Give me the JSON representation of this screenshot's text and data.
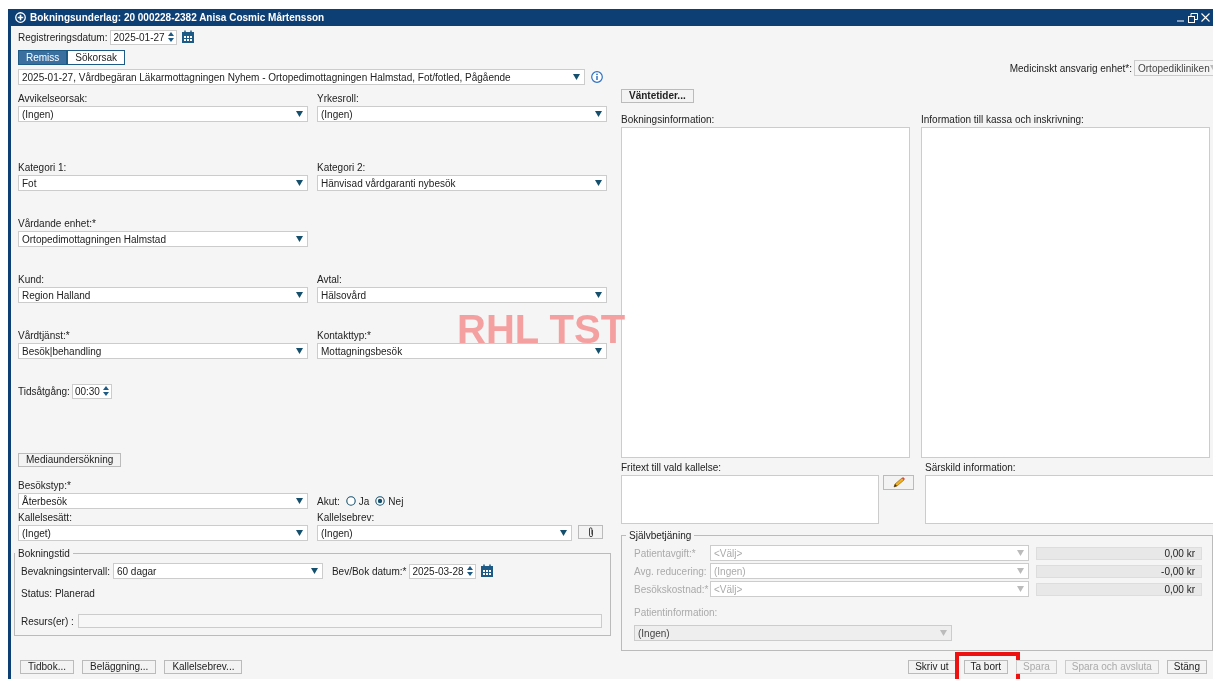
{
  "window": {
    "title": "Bokningsunderlag: 20 000228-2382 Anisa Cosmic Mårtensson"
  },
  "registration": {
    "label": "Registreringsdatum:",
    "value": "2025-01-27"
  },
  "tabs": [
    {
      "label": "Remiss",
      "selected": true
    },
    {
      "label": "Sökorsak",
      "selected": false
    }
  ],
  "referral": {
    "value": "2025-01-27, Vårdbegäran Läkarmottagningen Nyhem - Ortopedimottagningen Halmstad, Fot/fotled, Pågående"
  },
  "field_rows": [
    {
      "fields": [
        {
          "label": "Avvikelseorsak:",
          "value": "(Ingen)"
        },
        {
          "label": "Yrkesroll:",
          "value": "(Ingen)"
        }
      ]
    },
    {
      "fields": [
        {
          "label": "Kategori 1:",
          "value": "Fot"
        },
        {
          "label": "Kategori 2:",
          "value": "Hänvisad vårdgaranti nybesök"
        }
      ]
    },
    {
      "fields": [
        {
          "label": "Vårdande enhet:*",
          "value": "Ortopedimottagningen Halmstad"
        }
      ]
    },
    {
      "fields": [
        {
          "label": "Kund:",
          "value": "Region Halland"
        },
        {
          "label": "Avtal:",
          "value": "Hälsovård"
        }
      ]
    },
    {
      "fields": [
        {
          "label": "Vårdtjänst:*",
          "value": "Besök|behandling"
        },
        {
          "label": "Kontakttyp:*",
          "value": "Mottagningsbesök"
        }
      ]
    }
  ],
  "duration": {
    "label": "Tidsåtgång:",
    "value": "00:30"
  },
  "media_button": "Mediaundersökning",
  "visit_type": {
    "label": "Besökstyp:*",
    "value": "Återbesök"
  },
  "acute": {
    "label": "Akut:",
    "options": [
      {
        "label": "Ja",
        "selected": false
      },
      {
        "label": "Nej",
        "selected": true
      }
    ]
  },
  "notice_method": {
    "label": "Kallelsesätt:",
    "value": "(Inget)"
  },
  "notice_letter": {
    "label": "Kallelsebrev:",
    "value": "(Ingen)"
  },
  "booking_time": {
    "title": "Bokningstid",
    "interval": {
      "label": "Bevakningsintervall:",
      "value": "60 dagar"
    },
    "date": {
      "label": "Bev/Bok datum:*",
      "value": "2025-03-28"
    },
    "status": "Status: Planerad",
    "resources": {
      "label": "Resurs(er) :"
    }
  },
  "left_buttons": [
    "Tidbok...",
    "Beläggning...",
    "Kallelsebrev..."
  ],
  "responsible_unit": {
    "label": "Medicinskt ansvarig enhet*:",
    "value": "Ortopedikliniken",
    "disabled": true
  },
  "wait_button": "Väntetider...",
  "text_areas": [
    {
      "label": "Bokningsinformation:"
    },
    {
      "label": "Information till kassa och inskrivning:"
    }
  ],
  "free_text": {
    "label": "Fritext till vald kallelse:"
  },
  "special_info": {
    "label": "Särskild information:"
  },
  "self_service": {
    "title": "Självbetjäning",
    "disabled": true,
    "rows": [
      {
        "label": "Patientavgift:*",
        "value": "<Välj>",
        "amount": "0,00 kr"
      },
      {
        "label": "Avg. reducering:",
        "value": "(Ingen)",
        "amount": "-0,00 kr"
      },
      {
        "label": "Besökskostnad:*",
        "value": "<Välj>",
        "amount": "0,00 kr"
      }
    ],
    "patient_info": {
      "label": "Patientinformation:",
      "value": "(Ingen)"
    }
  },
  "footer_buttons": [
    {
      "label": "Skriv ut",
      "disabled": false,
      "highlighted": false
    },
    {
      "label": "Ta bort",
      "disabled": false,
      "highlighted": true
    },
    {
      "label": "Spara",
      "disabled": true,
      "highlighted": false
    },
    {
      "label": "Spara och avsluta",
      "disabled": true,
      "highlighted": false
    },
    {
      "label": "Stäng",
      "disabled": false,
      "highlighted": false
    }
  ],
  "environment_label": "RHL TST"
}
